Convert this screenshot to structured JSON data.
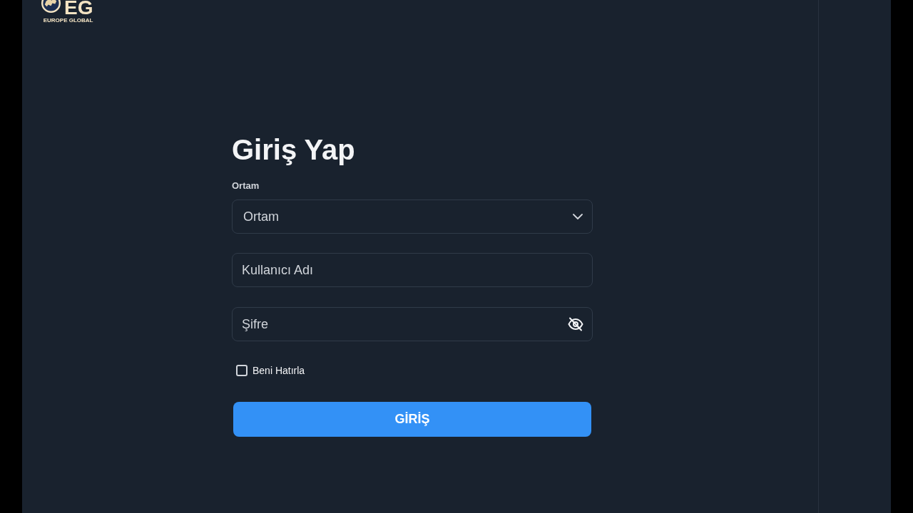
{
  "logo": {
    "mark": "EG",
    "caption": "EUROPE GLOBAL"
  },
  "form": {
    "title": "Giriş Yap",
    "environment": {
      "label": "Ortam",
      "value": "Ortam"
    },
    "username": {
      "placeholder": "Kullanıcı Adı"
    },
    "password": {
      "placeholder": "Şifre",
      "visible": false
    },
    "remember": {
      "label": "Beni Hatırla",
      "checked": false
    },
    "submit": {
      "label": "GİRİŞ"
    }
  }
}
